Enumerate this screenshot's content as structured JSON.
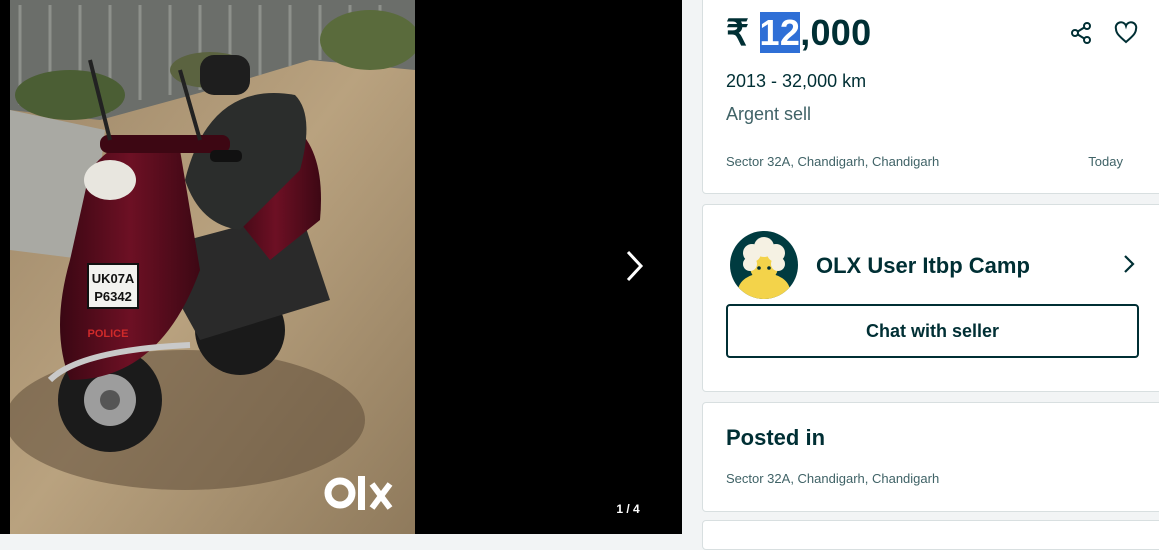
{
  "gallery": {
    "counter": "1 / 4",
    "watermark": "OLX",
    "plate_line1": "UK07A",
    "plate_line2": "P6342",
    "plate_tag": "POLICE"
  },
  "listing": {
    "currency": "₹",
    "price_highlighted": "12",
    "price_rest": ",000",
    "meta": "2013 - 32,000 km",
    "subtitle": "Argent sell",
    "location": "Sector 32A, Chandigarh, Chandigarh",
    "date": "Today"
  },
  "seller": {
    "name": "OLX User Itbp Camp",
    "chat_label": "Chat with seller"
  },
  "posted": {
    "title": "Posted in",
    "location": "Sector 32A, Chandigarh, Chandigarh"
  },
  "icons": {
    "share": "share-icon",
    "favorite": "heart-icon",
    "next": "chevron-right-icon",
    "seller_arrow": "chevron-right-icon"
  },
  "colors": {
    "brand_text": "#002f34",
    "secondary_text": "#406367",
    "selection": "#2f6fd6",
    "gallery_bg": "#000000",
    "page_bg": "#f2f4f5"
  }
}
